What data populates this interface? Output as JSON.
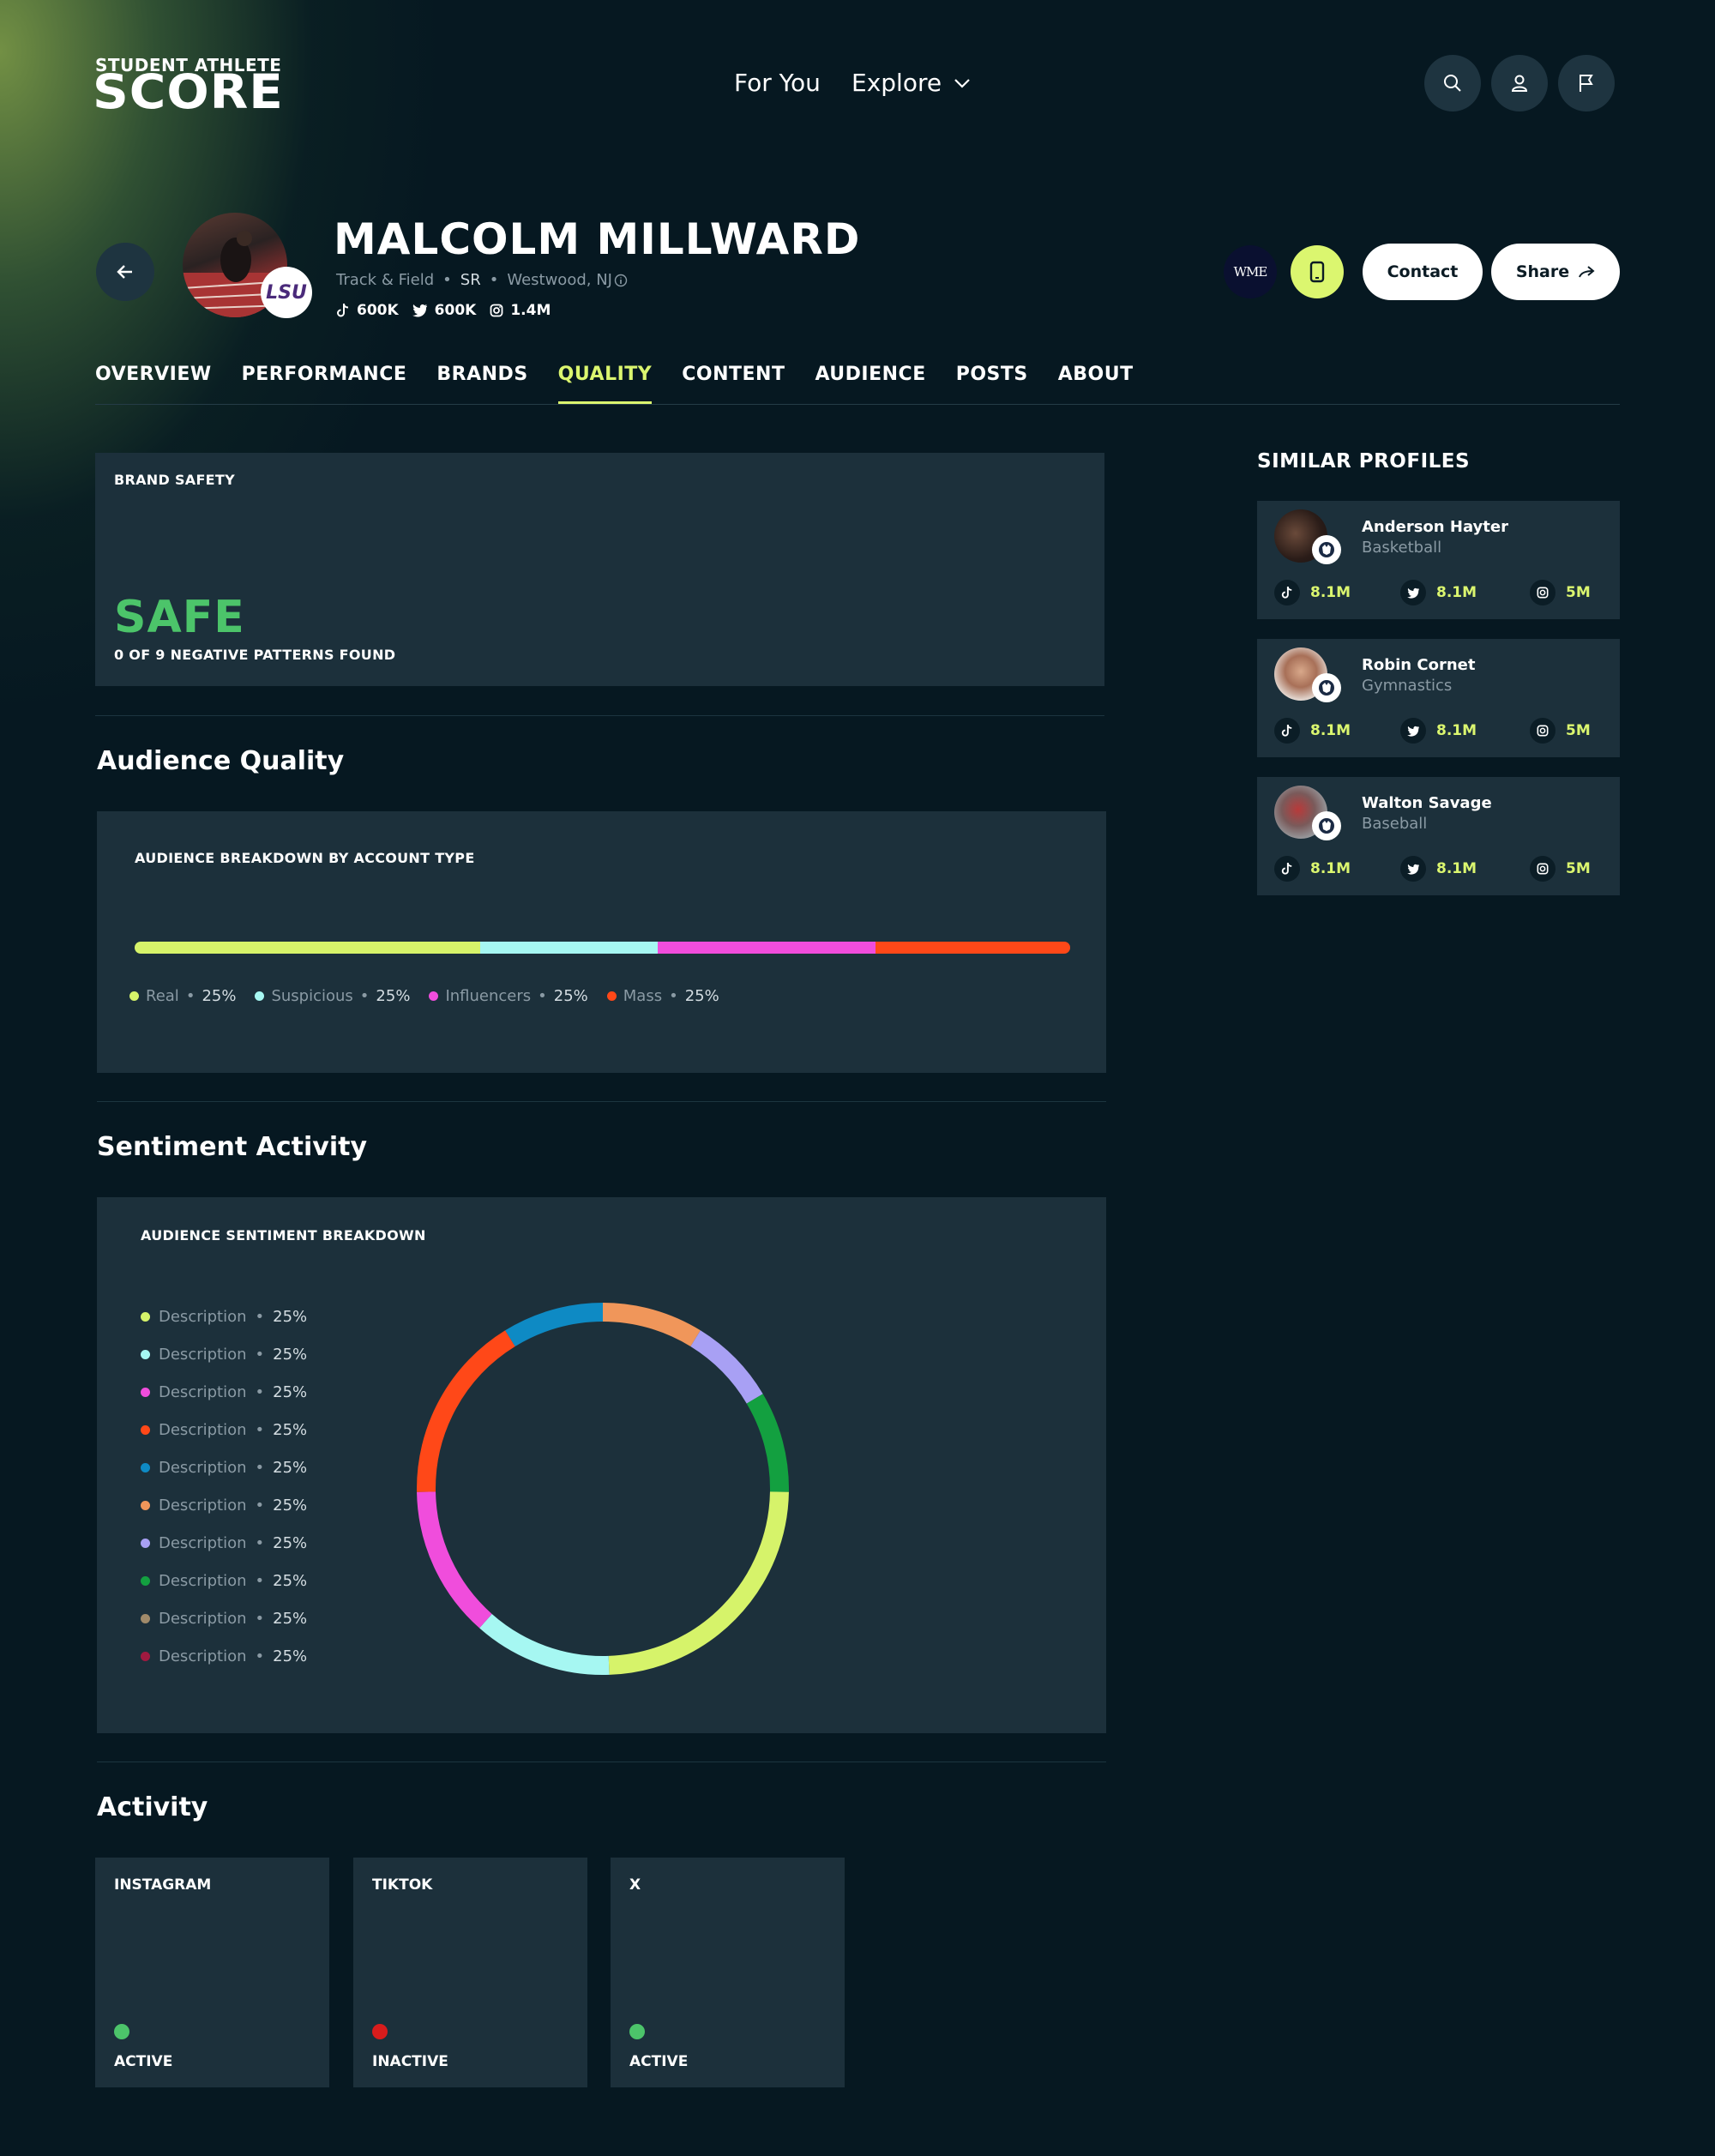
{
  "header": {
    "logo_top": "STUDENT ATHLETE",
    "logo_main": "SCORE",
    "nav_for_you": "For You",
    "nav_explore": "Explore"
  },
  "profile": {
    "name": "MALCOLM MILLWARD",
    "sport": "Track & Field",
    "year": "SR",
    "location": "Westwood, NJ",
    "school_badge": "LSU",
    "tiktok": "600K",
    "twitter": "600K",
    "instagram": "1.4M",
    "agency_logo": "WME",
    "contact_label": "Contact",
    "share_label": "Share"
  },
  "tabs": [
    {
      "label": "OVERVIEW",
      "active": false
    },
    {
      "label": "PERFORMANCE",
      "active": false
    },
    {
      "label": "BRANDS",
      "active": false
    },
    {
      "label": "QUALITY",
      "active": true
    },
    {
      "label": "CONTENT",
      "active": false
    },
    {
      "label": "AUDIENCE",
      "active": false
    },
    {
      "label": "POSTS",
      "active": false
    },
    {
      "label": "ABOUT",
      "active": false
    }
  ],
  "brand_safety": {
    "label": "BRAND SAFETY",
    "status": "SAFE",
    "detail": "0 OF 9 NEGATIVE PATTERNS FOUND",
    "status_color": "#4cc46a"
  },
  "audience_quality": {
    "title": "Audience Quality",
    "card_label": "AUDIENCE BREAKDOWN BY ACCOUNT TYPE",
    "segments": [
      {
        "name": "Real",
        "pct": "25%",
        "color": "#d6f36a"
      },
      {
        "name": "Suspicious",
        "pct": "25%",
        "color": "#a6f7f2"
      },
      {
        "name": "Influencers",
        "pct": "25%",
        "color": "#f04ddc"
      },
      {
        "name": "Mass",
        "pct": "25%",
        "color": "#ff4818"
      }
    ]
  },
  "sentiment": {
    "title": "Sentiment Activity",
    "card_label": "AUDIENCE SENTIMENT BREAKDOWN",
    "items": [
      {
        "label": "Description",
        "pct": "25%",
        "color": "#d6f36a"
      },
      {
        "label": "Description",
        "pct": "25%",
        "color": "#a6f7f2"
      },
      {
        "label": "Description",
        "pct": "25%",
        "color": "#f04ddc"
      },
      {
        "label": "Description",
        "pct": "25%",
        "color": "#ff4818"
      },
      {
        "label": "Description",
        "pct": "25%",
        "color": "#0e8ac4"
      },
      {
        "label": "Description",
        "pct": "25%",
        "color": "#f0965a"
      },
      {
        "label": "Description",
        "pct": "25%",
        "color": "#a8a0f4"
      },
      {
        "label": "Description",
        "pct": "25%",
        "color": "#13a040"
      },
      {
        "label": "Description",
        "pct": "25%",
        "color": "#a08a6a"
      },
      {
        "label": "Description",
        "pct": "25%",
        "color": "#a01a40"
      }
    ]
  },
  "chart_data": {
    "type": "pie",
    "variant": "donut",
    "title": "AUDIENCE SENTIMENT BREAKDOWN",
    "slices": [
      {
        "color": "#f0965a",
        "value": 8
      },
      {
        "color": "#a8a0f4",
        "value": 7
      },
      {
        "color": "#13a040",
        "value": 8
      },
      {
        "color": "#d6f36a",
        "value": 22
      },
      {
        "color": "#a6f7f2",
        "value": 11
      },
      {
        "color": "#f04ddc",
        "value": 12
      },
      {
        "color": "#ff4818",
        "value": 15
      },
      {
        "color": "#0e8ac4",
        "value": 8
      }
    ]
  },
  "similar_profiles": {
    "title": "SIMILAR PROFILES",
    "items": [
      {
        "name": "Anderson Hayter",
        "sport": "Basketball",
        "tiktok": "8.1M",
        "twitter": "8.1M",
        "instagram": "5M"
      },
      {
        "name": "Robin Cornet",
        "sport": "Gymnastics",
        "tiktok": "8.1M",
        "twitter": "8.1M",
        "instagram": "5M"
      },
      {
        "name": "Walton Savage",
        "sport": "Baseball",
        "tiktok": "8.1M",
        "twitter": "8.1M",
        "instagram": "5M"
      }
    ]
  },
  "activity": {
    "title": "Activity",
    "items": [
      {
        "platform": "INSTAGRAM",
        "status": "ACTIVE",
        "color": "#4cc46a"
      },
      {
        "platform": "TIKTOK",
        "status": "INACTIVE",
        "color": "#d81c1c"
      },
      {
        "platform": "X",
        "status": "ACTIVE",
        "color": "#4cc46a"
      }
    ]
  },
  "colors": {
    "accent": "#dbf66f",
    "background": "#061821",
    "card": "#1c303b"
  }
}
